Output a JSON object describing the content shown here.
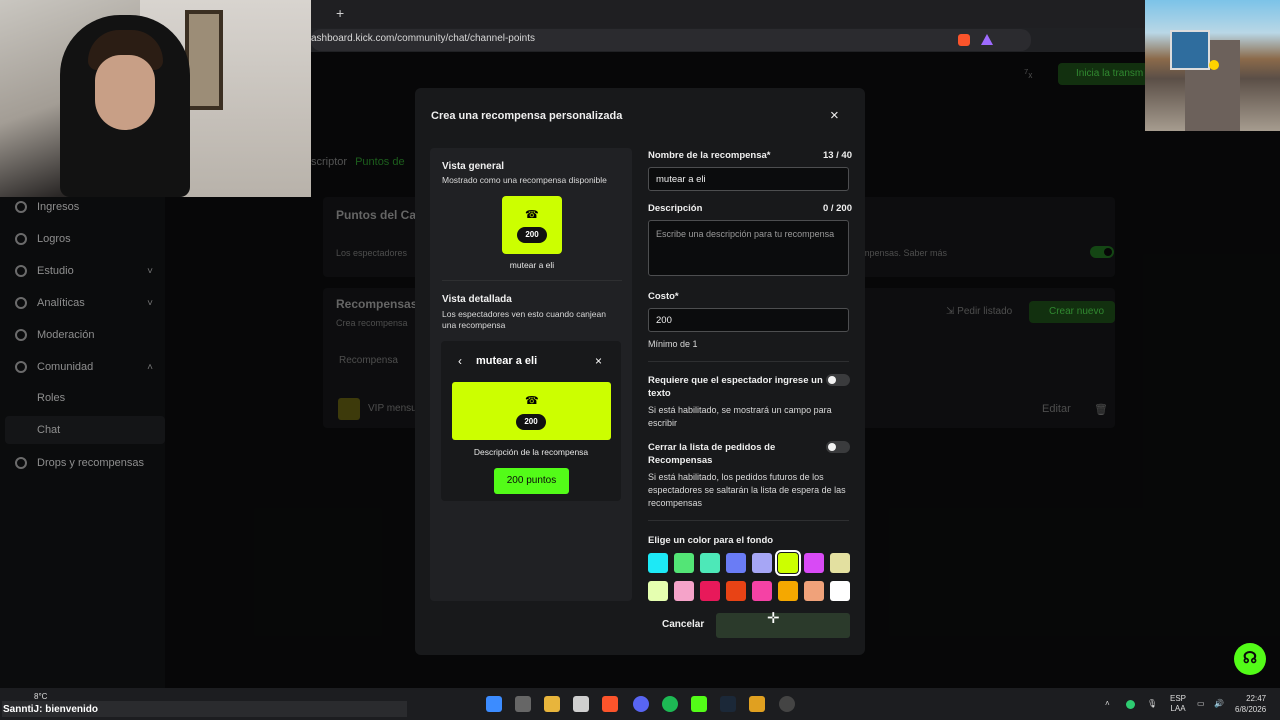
{
  "browser": {
    "url": "ashboard.kick.com/community/chat/channel-points",
    "new_tab": "+"
  },
  "dashboard": {
    "top_action": "Inicia la transm",
    "breadcrumb_prev": "scriptor",
    "breadcrumb_current": "Puntos de",
    "sidebar": [
      {
        "label": "Ingresos"
      },
      {
        "label": "Logros"
      },
      {
        "label": "Estudio",
        "chevron": "˅"
      },
      {
        "label": "Analíticas",
        "chevron": "˅"
      },
      {
        "label": "Moderación"
      },
      {
        "label": "Comunidad",
        "chevron": "˄"
      },
      {
        "label": "Drops y recompensas"
      }
    ],
    "sidebar_sub": [
      "Roles",
      "Chat"
    ],
    "panel1_title": "Puntos del Ca",
    "panel1_text": "Los espectadores",
    "panel1_right_text": "mpensas. Saber más",
    "panel2_title": "Recompensas",
    "panel2_sub": "Crea recompensa",
    "request_list": "Pedir listado",
    "create_new": "Crear nuevo",
    "table_header": "Recompensa",
    "vip_text": "VIP mensu",
    "edit": "Editar"
  },
  "modal": {
    "title": "Crea una recompensa personalizada",
    "close_icon": "×",
    "overview_title": "Vista general",
    "overview_sub": "Mostrado como una recompensa disponible",
    "card_cost": "200",
    "card_name": "mutear a eli",
    "detail_title": "Vista detallada",
    "detail_sub": "Los espectadores ven esto cuando canjean una recompensa",
    "detail_name": "mutear a eli",
    "detail_cost": "200",
    "detail_desc": "Descripción de la recompensa",
    "detail_button": "200 puntos",
    "accent_color": "#ccff00",
    "form": {
      "name_label": "Nombre de la recompensa*",
      "name_count": "13 / 40",
      "name_value": "mutear a eli",
      "desc_label": "Descripción",
      "desc_count": "0 / 200",
      "desc_placeholder": "Escribe una descripción para tu recompensa",
      "cost_label": "Costo*",
      "cost_value": "200",
      "cost_hint": "Mínimo de 1",
      "toggle1_label": "Requiere que el espectador ingrese un texto",
      "toggle1_desc": "Si está habilitado, se mostrará un campo para escribir",
      "toggle2_label": "Cerrar la lista de pedidos de Recompensas",
      "toggle2_desc": "Si está habilitado, los pedidos futuros de los espectadores se saltarán la lista de espera de las recompensas",
      "color_label": "Elige un color para el fondo",
      "colors_row1": [
        "#1de9f6",
        "#53e576",
        "#4de8b8",
        "#6a7cf5",
        "#a6a6f5",
        "#ccff00",
        "#d84af5",
        "#e3e0a0"
      ],
      "colors_row2": [
        "#e5ffb0",
        "#f5a3c9",
        "#e8195a",
        "#e84315",
        "#f542a5",
        "#f5a800",
        "#f0a27a",
        "#ffffff"
      ],
      "cancel": "Cancelar"
    }
  },
  "taskbar": {
    "weather": "8°C",
    "chat_text": "SanntiJ: bienvenido",
    "lang_line1": "ESP",
    "lang_line2": "LAA",
    "time": "22:47",
    "date": "6/8/2026"
  }
}
